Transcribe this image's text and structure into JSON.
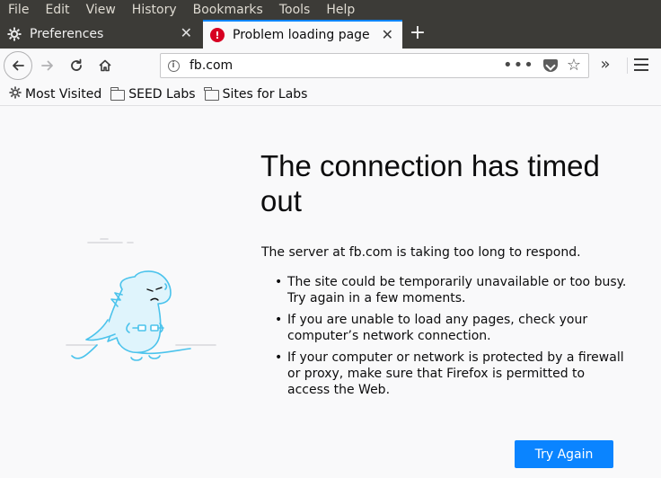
{
  "menubar": {
    "items": [
      {
        "label": "File"
      },
      {
        "label": "Edit"
      },
      {
        "label": "View"
      },
      {
        "label": "History"
      },
      {
        "label": "Bookmarks"
      },
      {
        "label": "Tools"
      },
      {
        "label": "Help"
      }
    ]
  },
  "tabs": [
    {
      "label": "Preferences",
      "icon": "gear-icon"
    },
    {
      "label": "Problem loading page",
      "icon": "error-icon",
      "active": true
    }
  ],
  "urlbar": {
    "url": "fb.com"
  },
  "bookmarks": [
    {
      "label": "Most Visited",
      "icon": "gear-icon"
    },
    {
      "label": "SEED Labs",
      "icon": "folder-icon"
    },
    {
      "label": "Sites for Labs",
      "icon": "folder-icon"
    }
  ],
  "error": {
    "title": "The connection has timed out",
    "description": "The server at fb.com is taking too long to respond.",
    "bullets": [
      "The site could be temporarily unavailable or too busy. Try again in a few moments.",
      "If you are unable to load any pages, check your computer’s network connection.",
      "If your computer or network is protected by a firewall or proxy, make sure that Firefox is permitted to access the Web."
    ],
    "button": "Try Again"
  },
  "colors": {
    "accent": "#0a84ff",
    "chrome_dark": "#3c3b37",
    "error_red": "#d70022",
    "illustration_blue": "#4bc3ec"
  }
}
